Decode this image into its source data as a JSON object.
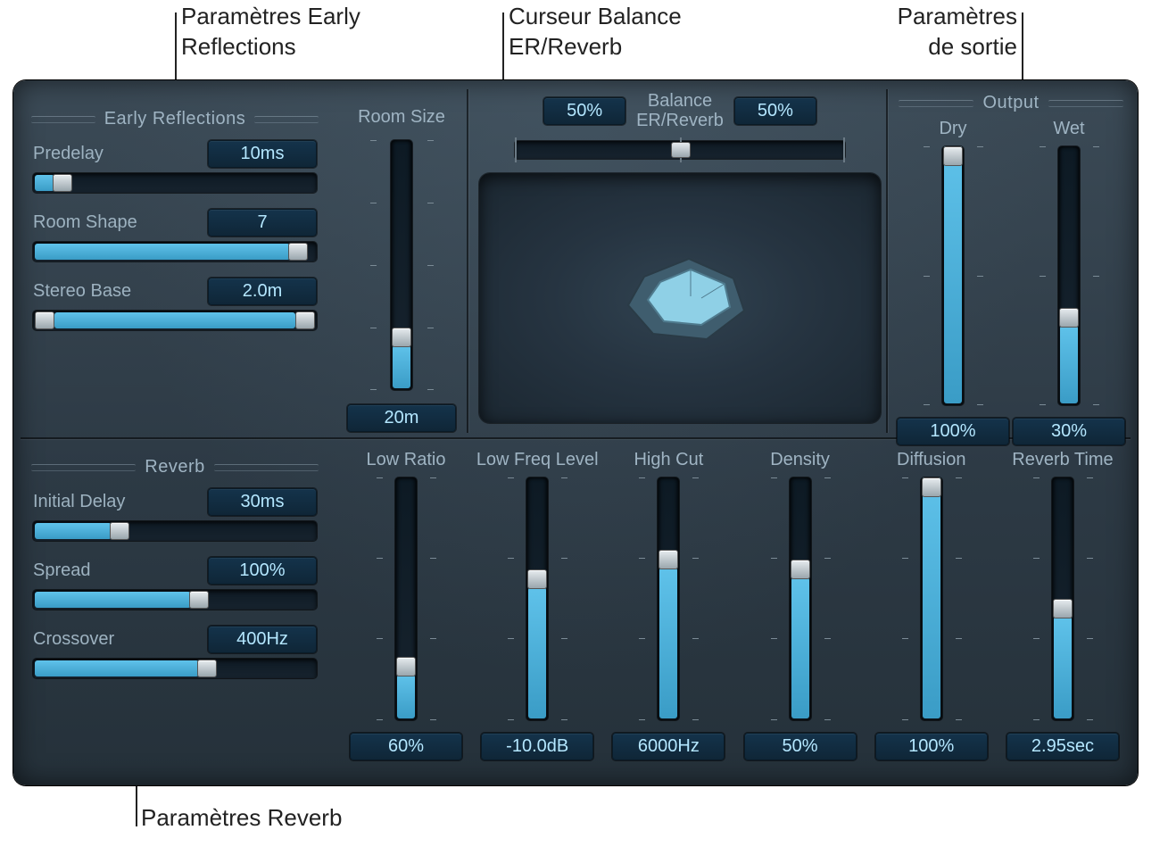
{
  "callouts": {
    "early": "Paramètres Early\nReflections",
    "balance": "Curseur Balance\nER/Reverb",
    "output": "Paramètres\nde sortie",
    "reverb": "Paramètres Reverb"
  },
  "earlyReflections": {
    "title": "Early Reflections",
    "predelay": {
      "label": "Predelay",
      "value": "10ms",
      "pct": 8
    },
    "roomShape": {
      "label": "Room Shape",
      "value": "7",
      "pct": 92
    },
    "stereoBase": {
      "label": "Stereo Base",
      "value": "2.0m"
    },
    "roomSize": {
      "label": "Room Size",
      "value": "20m",
      "pct": 18
    }
  },
  "balance": {
    "title": "Balance\nER/Reverb",
    "left": "50%",
    "right": "50%",
    "pos": 50
  },
  "output": {
    "title": "Output",
    "dry": {
      "label": "Dry",
      "value": "100%",
      "pct": 100
    },
    "wet": {
      "label": "Wet",
      "value": "30%",
      "pct": 30
    }
  },
  "reverb": {
    "title": "Reverb",
    "initialDelay": {
      "label": "Initial Delay",
      "value": "30ms",
      "pct": 28
    },
    "spread": {
      "label": "Spread",
      "value": "100%",
      "pct": 56
    },
    "crossover": {
      "label": "Crossover",
      "value": "400Hz",
      "pct": 58
    },
    "lowRatio": {
      "label": "Low Ratio",
      "value": "60%",
      "pct": 18
    },
    "lowFreqLevel": {
      "label": "Low Freq Level",
      "value": "-10.0dB",
      "pct": 54
    },
    "highCut": {
      "label": "High Cut",
      "value": "6000Hz",
      "pct": 62
    },
    "density": {
      "label": "Density",
      "value": "50%",
      "pct": 58
    },
    "diffusion": {
      "label": "Diffusion",
      "value": "100%",
      "pct": 100
    },
    "reverbTime": {
      "label": "Reverb Time",
      "value": "2.95sec",
      "pct": 42
    }
  }
}
